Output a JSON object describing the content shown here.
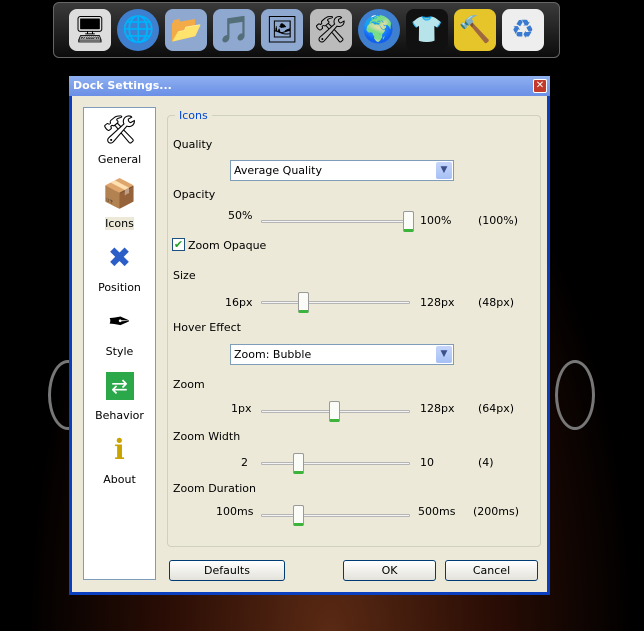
{
  "dock": {
    "items": [
      "my-computer",
      "network",
      "documents-folder",
      "music-folder",
      "pictures-folder",
      "system-tools",
      "internet",
      "t-shirt",
      "tools",
      "recycle-bin"
    ]
  },
  "dialog": {
    "title": "Dock Settings...",
    "close": "✕"
  },
  "sidebar": {
    "items": [
      {
        "label": "General",
        "icon": "🛠"
      },
      {
        "label": "Icons",
        "icon": "📦"
      },
      {
        "label": "Position",
        "icon": "✖"
      },
      {
        "label": "Style",
        "icon": "✒"
      },
      {
        "label": "Behavior",
        "icon": "⇄"
      },
      {
        "label": "About",
        "icon": "ℹ"
      }
    ],
    "selected": "Icons"
  },
  "icons": {
    "group_title": "Icons",
    "quality": {
      "label": "Quality",
      "value": "Average Quality"
    },
    "opacity": {
      "label": "Opacity",
      "min": "50%",
      "max": "100%",
      "current": "(100%)",
      "value": 100,
      "range": [
        50,
        100
      ]
    },
    "zoom_opaque": {
      "label": "Zoom Opaque",
      "checked": true
    },
    "size": {
      "label": "Size",
      "min": "16px",
      "max": "128px",
      "current": "(48px)",
      "value": 48,
      "range": [
        16,
        128
      ]
    },
    "hover": {
      "label": "Hover Effect",
      "value": "Zoom: Bubble"
    },
    "zoom": {
      "label": "Zoom",
      "min": "1px",
      "max": "128px",
      "current": "(64px)",
      "value": 64,
      "range": [
        1,
        128
      ]
    },
    "zoom_width": {
      "label": "Zoom Width",
      "min": "2",
      "max": "10",
      "current": "(4)",
      "value": 4,
      "range": [
        2,
        10
      ]
    },
    "zoom_duration": {
      "label": "Zoom Duration",
      "min": "100ms",
      "max": "500ms",
      "current": "(200ms)",
      "value": 200,
      "range": [
        100,
        500
      ]
    }
  },
  "buttons": {
    "defaults": "Defaults",
    "ok": "OK",
    "cancel": "Cancel"
  }
}
